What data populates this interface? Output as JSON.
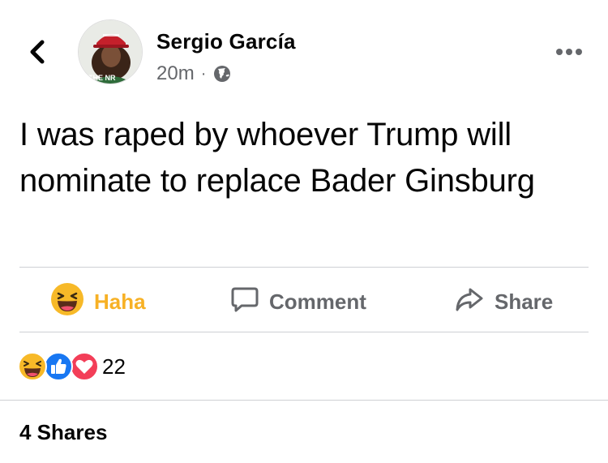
{
  "post": {
    "author_name": "Sergio García",
    "time": "20m",
    "separator": "·",
    "text": "I was raped by whoever Trump will nominate to replace Bader Ginsburg",
    "avatar_hat_text": "THE NR"
  },
  "actions": {
    "haha_label": "Haha",
    "comment_label": "Comment",
    "share_label": "Share"
  },
  "reactions": {
    "count": "22",
    "icons": [
      "haha-icon",
      "like-icon",
      "love-icon"
    ]
  },
  "shares": {
    "label": "4 Shares"
  },
  "colors": {
    "haha": "#f7b125",
    "like": "#1877f2",
    "love": "#f33e58",
    "secondary_text": "#65676b",
    "divider": "#ced0d4"
  }
}
